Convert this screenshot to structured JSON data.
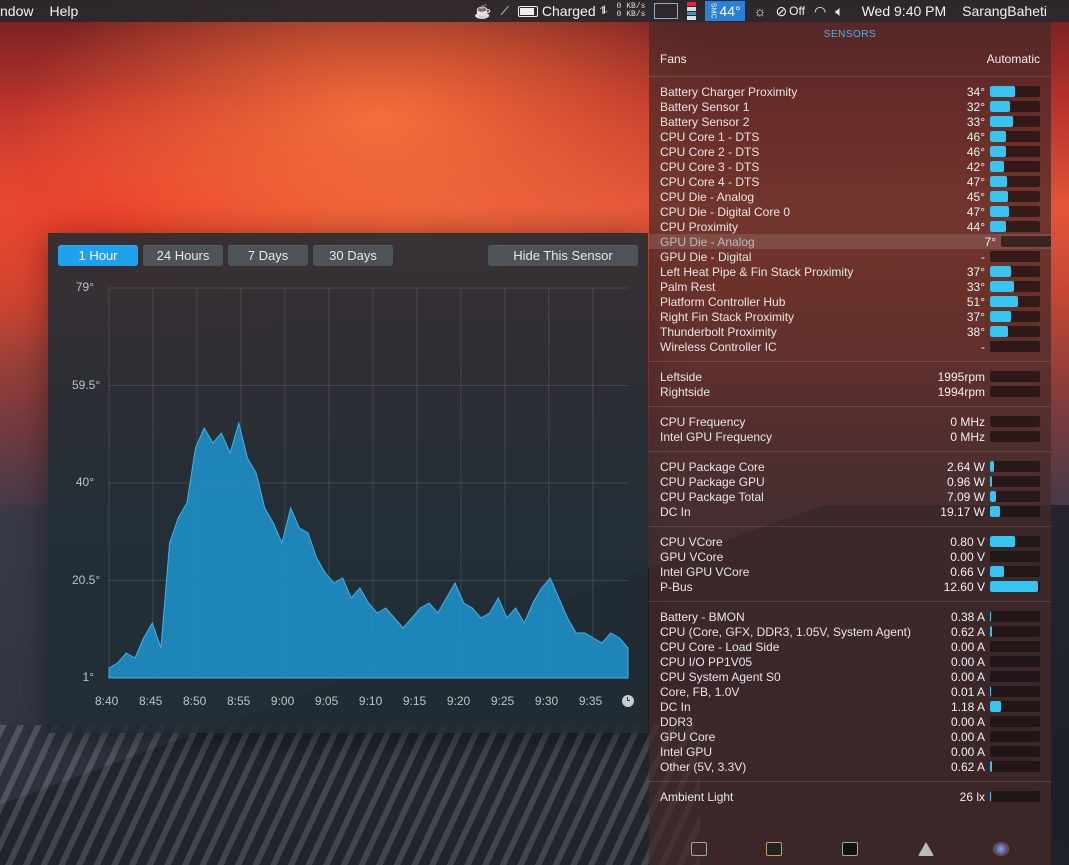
{
  "menubar": {
    "left": [
      "ndow",
      "Help"
    ],
    "net_up": "0 KB/s",
    "net_down": "0 KB/s",
    "battery_text": "Charged",
    "temp_badge": "44°",
    "mute_text": "Off",
    "clock": "Wed 9:40 PM",
    "user": "SarangBaheti",
    "icons": [
      "coffee-cup-icon",
      "antenna-icon",
      "battery-icon",
      "cpu-graph-icon",
      "memory-icon",
      "temperature-icon",
      "brightness-icon",
      "accessibility-icon",
      "wifi-icon",
      "volume-icon"
    ]
  },
  "graph": {
    "buttons": [
      {
        "label": "1 Hour",
        "active": true
      },
      {
        "label": "24 Hours",
        "active": false
      },
      {
        "label": "7 Days",
        "active": false
      },
      {
        "label": "30 Days",
        "active": false
      }
    ],
    "hide_label": "Hide This Sensor",
    "y_ticks": [
      "79°",
      "59.5°",
      "40°",
      "20.5°",
      "1°"
    ],
    "x_ticks": [
      "8:40",
      "8:45",
      "8:50",
      "8:55",
      "9:00",
      "9:05",
      "9:10",
      "9:15",
      "9:20",
      "9:25",
      "9:30",
      "9:35"
    ]
  },
  "chart_data": {
    "type": "area",
    "ylim": [
      1,
      79
    ],
    "y_ticks": [
      1,
      20.5,
      40,
      59.5,
      79
    ],
    "x_ticks": [
      "8:40",
      "8:45",
      "8:50",
      "8:55",
      "9:00",
      "9:05",
      "9:10",
      "9:15",
      "9:20",
      "9:25",
      "9:30",
      "9:35"
    ],
    "series": [
      {
        "x": [
          "8:40",
          "8:41",
          "8:42",
          "8:43",
          "8:44",
          "8:45",
          "8:46",
          "8:47",
          "8:48",
          "8:49",
          "8:50",
          "8:51",
          "8:52",
          "8:53",
          "8:54",
          "8:55",
          "8:56",
          "8:57",
          "8:58",
          "8:59",
          "9:00",
          "9:01",
          "9:02",
          "9:03",
          "9:04",
          "9:05",
          "9:06",
          "9:07",
          "9:08",
          "9:09",
          "9:10",
          "9:11",
          "9:12",
          "9:13",
          "9:14",
          "9:15",
          "9:16",
          "9:17",
          "9:18",
          "9:19",
          "9:20",
          "9:21",
          "9:22",
          "9:23",
          "9:24",
          "9:25",
          "9:26",
          "9:27",
          "9:28",
          "9:29",
          "9:30",
          "9:31",
          "9:32",
          "9:33",
          "9:34",
          "9:35",
          "9:36",
          "9:37",
          "9:38",
          "9:39",
          "9:40"
        ],
        "values": [
          3,
          4,
          6,
          5,
          9,
          12,
          7,
          28,
          33,
          36,
          47,
          51,
          48,
          50,
          46,
          52,
          45,
          42,
          35,
          32,
          28,
          35,
          31,
          30,
          25,
          22,
          20,
          21,
          17,
          19,
          16,
          14,
          15,
          13,
          11,
          13,
          15,
          16,
          14,
          17,
          20,
          16,
          15,
          13,
          14,
          17,
          13,
          15,
          12,
          16,
          19,
          21,
          17,
          13,
          10,
          10,
          9,
          8,
          10,
          9,
          7
        ]
      }
    ]
  },
  "sensors": {
    "title": "SENSORS",
    "fans_label": "Fans",
    "fans_mode": "Automatic",
    "temperatures": [
      {
        "label": "Battery Charger Proximity",
        "value": "34°",
        "fill": 0.5
      },
      {
        "label": "Battery Sensor 1",
        "value": "32°",
        "fill": 0.4
      },
      {
        "label": "Battery Sensor 2",
        "value": "33°",
        "fill": 0.45
      },
      {
        "label": "CPU Core 1 - DTS",
        "value": "46°",
        "fill": 0.32
      },
      {
        "label": "CPU Core 2 - DTS",
        "value": "46°",
        "fill": 0.32
      },
      {
        "label": "CPU Core 3 - DTS",
        "value": "42°",
        "fill": 0.28
      },
      {
        "label": "CPU Core 4 - DTS",
        "value": "47°",
        "fill": 0.34
      },
      {
        "label": "CPU Die - Analog",
        "value": "45°",
        "fill": 0.36
      },
      {
        "label": "CPU Die - Digital Core 0",
        "value": "47°",
        "fill": 0.38
      },
      {
        "label": "CPU Proximity",
        "value": "44°",
        "fill": 0.32
      },
      {
        "label": "GPU Die - Analog",
        "value": "7°",
        "fill": 0.0,
        "highlight": true
      },
      {
        "label": "GPU Die - Digital",
        "value": "-",
        "fill": 0.0
      },
      {
        "label": "Left Heat Pipe & Fin Stack Proximity",
        "value": "37°",
        "fill": 0.42
      },
      {
        "label": "Palm Rest",
        "value": "33°",
        "fill": 0.48
      },
      {
        "label": "Platform Controller Hub",
        "value": "51°",
        "fill": 0.55
      },
      {
        "label": "Right Fin Stack Proximity",
        "value": "37°",
        "fill": 0.42
      },
      {
        "label": "Thunderbolt Proximity",
        "value": "38°",
        "fill": 0.36
      },
      {
        "label": "Wireless Controller IC",
        "value": "-",
        "fill": 0.0
      }
    ],
    "fans": [
      {
        "label": "Leftside",
        "value": "1995rpm",
        "fill": 0.0
      },
      {
        "label": "Rightside",
        "value": "1994rpm",
        "fill": 0.0
      }
    ],
    "frequencies": [
      {
        "label": "CPU Frequency",
        "value": "0 MHz",
        "fill": 0.0
      },
      {
        "label": "Intel GPU Frequency",
        "value": "0 MHz",
        "fill": 0.0
      }
    ],
    "power": [
      {
        "label": "CPU Package Core",
        "value": "2.64 W",
        "fill": 0.08
      },
      {
        "label": "CPU Package GPU",
        "value": "0.96 W",
        "fill": 0.03
      },
      {
        "label": "CPU Package Total",
        "value": "7.09 W",
        "fill": 0.12
      },
      {
        "label": "DC In",
        "value": "19.17 W",
        "fill": 0.2
      }
    ],
    "voltage": [
      {
        "label": "CPU VCore",
        "value": "0.80 V",
        "fill": 0.5
      },
      {
        "label": "GPU VCore",
        "value": "0.00 V",
        "fill": 0.0
      },
      {
        "label": "Intel GPU VCore",
        "value": "0.66 V",
        "fill": 0.28
      },
      {
        "label": "P-Bus",
        "value": "12.60 V",
        "fill": 0.95
      }
    ],
    "current": [
      {
        "label": "Battery - BMON",
        "value": "0.38 A",
        "fill": 0.02
      },
      {
        "label": "CPU (Core, GFX, DDR3, 1.05V, System Agent)",
        "value": "0.62 A",
        "fill": 0.03
      },
      {
        "label": "CPU Core - Load Side",
        "value": "0.00 A",
        "fill": 0.0
      },
      {
        "label": "CPU I/O PP1V05",
        "value": "0.00 A",
        "fill": 0.0
      },
      {
        "label": "CPU System Agent S0",
        "value": "0.00 A",
        "fill": 0.0
      },
      {
        "label": "Core, FB, 1.0V",
        "value": "0.01 A",
        "fill": 0.02
      },
      {
        "label": "DC In",
        "value": "1.18 A",
        "fill": 0.22
      },
      {
        "label": "DDR3",
        "value": "0.00 A",
        "fill": 0.0
      },
      {
        "label": "GPU Core",
        "value": "0.00 A",
        "fill": 0.0
      },
      {
        "label": "Intel GPU",
        "value": "0.00 A",
        "fill": 0.0
      },
      {
        "label": "Other (5V, 3.3V)",
        "value": "0.62 A",
        "fill": 0.03
      }
    ],
    "light": [
      {
        "label": "Ambient Light",
        "value": "26 lx",
        "fill": 0.02
      }
    ],
    "footer_icons": [
      "cpu-monitor-icon",
      "chip-icon",
      "terminal-icon",
      "fan-icon",
      "menu-meters-icon"
    ]
  }
}
